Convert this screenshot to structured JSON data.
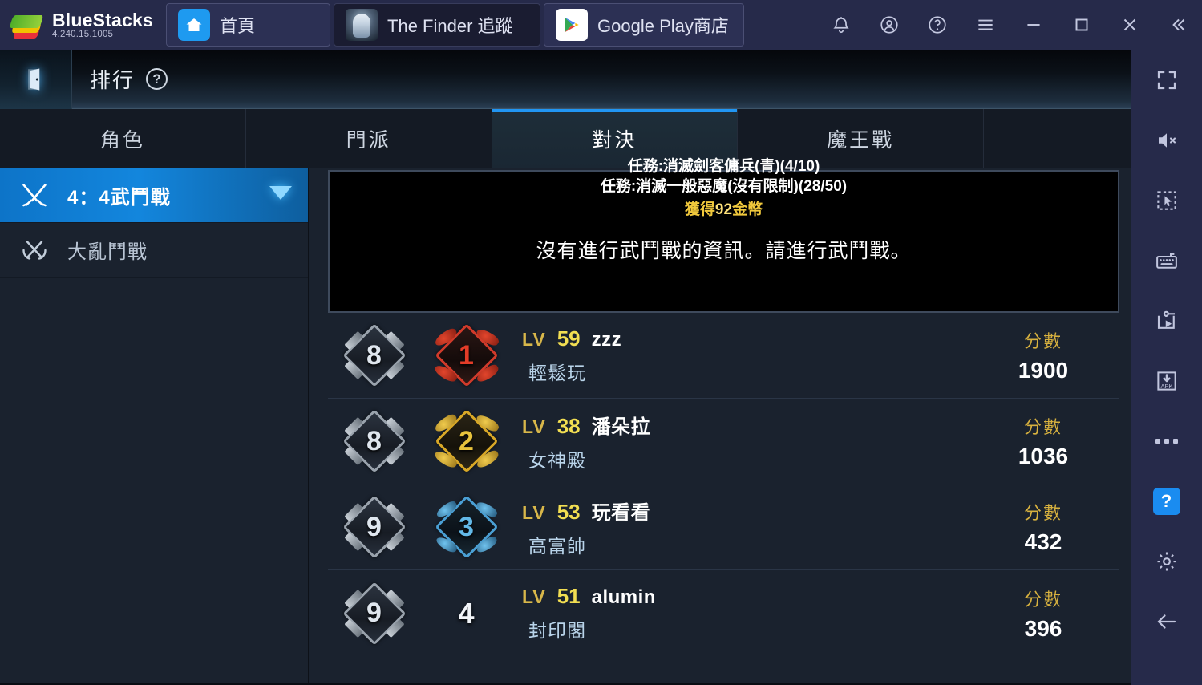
{
  "bluestacks": {
    "brand": "BlueStacks",
    "version": "4.240.15.1005",
    "tabs": [
      {
        "label": "首頁",
        "icon": "home-icon"
      },
      {
        "label": "The Finder  追蹤",
        "icon": "game-avatar-icon"
      },
      {
        "label": "Google Play商店",
        "icon": "google-play-icon"
      }
    ],
    "actions": [
      {
        "name": "notifications-icon"
      },
      {
        "name": "account-icon"
      },
      {
        "name": "help-icon"
      },
      {
        "name": "menu-icon"
      },
      {
        "name": "minimize-icon"
      },
      {
        "name": "maximize-icon"
      },
      {
        "name": "close-icon"
      },
      {
        "name": "collapse-icon"
      }
    ]
  },
  "rail": {
    "items": [
      {
        "name": "fullscreen-icon"
      },
      {
        "name": "mute-icon"
      },
      {
        "name": "select-region-icon"
      },
      {
        "name": "keyboard-controls-icon"
      },
      {
        "name": "macro-recorder-icon"
      },
      {
        "name": "install-apk-icon"
      },
      {
        "name": "more-options-icon"
      },
      {
        "name": "help-icon",
        "label": "?"
      },
      {
        "name": "settings-gear-icon"
      },
      {
        "name": "back-arrow-icon"
      }
    ]
  },
  "game": {
    "header": {
      "title": "排行",
      "help": "?",
      "exit_icon": "exit-door-icon"
    },
    "tabs": [
      {
        "label": "角色",
        "active": false
      },
      {
        "label": "門派",
        "active": false
      },
      {
        "label": "對決",
        "active": true
      },
      {
        "label": "魔王戰",
        "active": false
      }
    ],
    "sidebar": [
      {
        "label": "4：4武鬥戰",
        "icon": "crossed-swords-icon",
        "selected": true
      },
      {
        "label": "大亂鬥戰",
        "icon": "crossed-swords-wreath-icon",
        "selected": false
      }
    ],
    "notice": {
      "quest_overflow": "任務:消滅劍客傭兵(青)(4/10)",
      "quest_lines": [
        "任務:消滅一般惡魔(沒有限制)(28/50)"
      ],
      "gold_prefix": "獲得",
      "gold_amount": "92",
      "gold_suffix": "金幣",
      "message": "沒有進行武鬥戰的資訊。請進行武鬥戰。"
    },
    "score_label": "分數",
    "level_prefix": "LV",
    "rows": [
      {
        "tier": "8",
        "rank": "1",
        "rank_style": "r1",
        "level": "59",
        "name": "zzz",
        "guild": "輕鬆玩",
        "score": "1900"
      },
      {
        "tier": "8",
        "rank": "2",
        "rank_style": "r2",
        "level": "38",
        "name": "潘朵拉",
        "guild": "女神殿",
        "score": "1036"
      },
      {
        "tier": "9",
        "rank": "3",
        "rank_style": "r3",
        "level": "53",
        "name": "玩看看",
        "guild": "高富帥",
        "score": "432"
      },
      {
        "tier": "9",
        "rank": "4",
        "rank_style": "plain",
        "level": "51",
        "name": "alumin",
        "guild": "封印閣",
        "score": "396"
      }
    ]
  },
  "colors": {
    "accent_blue": "#2196f3",
    "gold": "#d7b13f",
    "panel_bg": "#1a222e",
    "topbar_bg": "#262a4a"
  }
}
